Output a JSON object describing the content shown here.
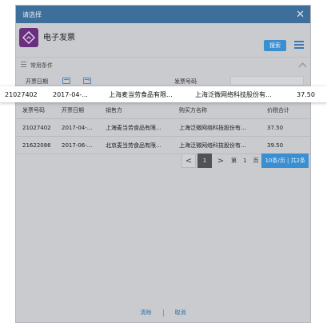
{
  "dialog": {
    "title": "请选择",
    "close_glyph": "✕",
    "app_title": "电子发票",
    "search_label": "搜索",
    "section_label": "常用条件",
    "filter": {
      "date_label": "开票日期",
      "date_sep": "-",
      "invoice_no_label": "发票号码",
      "invoice_no_value": ""
    }
  },
  "table": {
    "headers": [
      "发票号码",
      "开票日期",
      "销售方",
      "购买方名称",
      "价税合计"
    ],
    "rows": [
      [
        "21027402",
        "2017-04-...",
        "上海麦当劳食品有限...",
        "上海泛微网络科技股份有...",
        "37.50"
      ],
      [
        "21622086",
        "2017-06-...",
        "北京麦当劳食品有限...",
        "上海泛微网络科技股份有...",
        "39.50"
      ]
    ]
  },
  "highlight": [
    "21027402",
    "2017-04-...",
    "上海麦当劳食品有限...",
    "上海泛微网络科技股份有...",
    "37.50"
  ],
  "pager": {
    "prev": "<",
    "current": "1",
    "next": ">",
    "goto_prefix": "第",
    "goto_page": "1",
    "goto_suffix": "页",
    "size_info": "10条/页 | 共2条"
  },
  "footer": {
    "clear_label": "清除",
    "cancel_label": "取消"
  },
  "colors": {
    "titlebar": "#3d6f9a",
    "accent": "#3a8fd1",
    "app_icon": "#6a2f7e"
  }
}
